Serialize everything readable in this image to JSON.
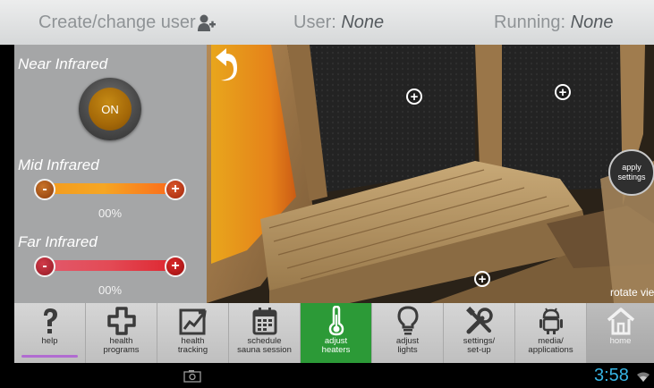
{
  "topbar": {
    "create_label": "Create/change user",
    "user_label": "User:",
    "user_value": "None",
    "running_label": "Running:",
    "running_value": "None"
  },
  "controls": {
    "near": {
      "title": "Near Infrared",
      "button": "ON"
    },
    "mid": {
      "title": "Mid Infrared",
      "minus": "-",
      "plus": "+",
      "percent": "00%",
      "level": 0
    },
    "far": {
      "title": "Far Infrared",
      "minus": "-",
      "plus": "+",
      "percent": "00%",
      "level": 0
    }
  },
  "scene": {
    "apply_label": "apply settings",
    "rotate_label": "rotate vie",
    "hotspot_symbol": "+"
  },
  "nav": [
    {
      "label": "help",
      "icon": "question-icon"
    },
    {
      "label": "health\nprograms",
      "icon": "cross-icon"
    },
    {
      "label": "health\ntracking",
      "icon": "chart-icon"
    },
    {
      "label": "schedule\nsauna session",
      "icon": "calendar-icon"
    },
    {
      "label": "adjust\nheaters",
      "icon": "thermometer-icon",
      "active": true
    },
    {
      "label": "adjust\nlights",
      "icon": "lightbulb-icon"
    },
    {
      "label": "settings/\nset-up",
      "icon": "tools-icon"
    },
    {
      "label": "media/\napplications",
      "icon": "android-icon"
    },
    {
      "label": "home",
      "icon": "home-icon"
    }
  ],
  "system": {
    "time": "3:58"
  },
  "colors": {
    "active_nav": "#2c9a37",
    "clock": "#36b4e3",
    "help_underline": "#b16cd1"
  }
}
